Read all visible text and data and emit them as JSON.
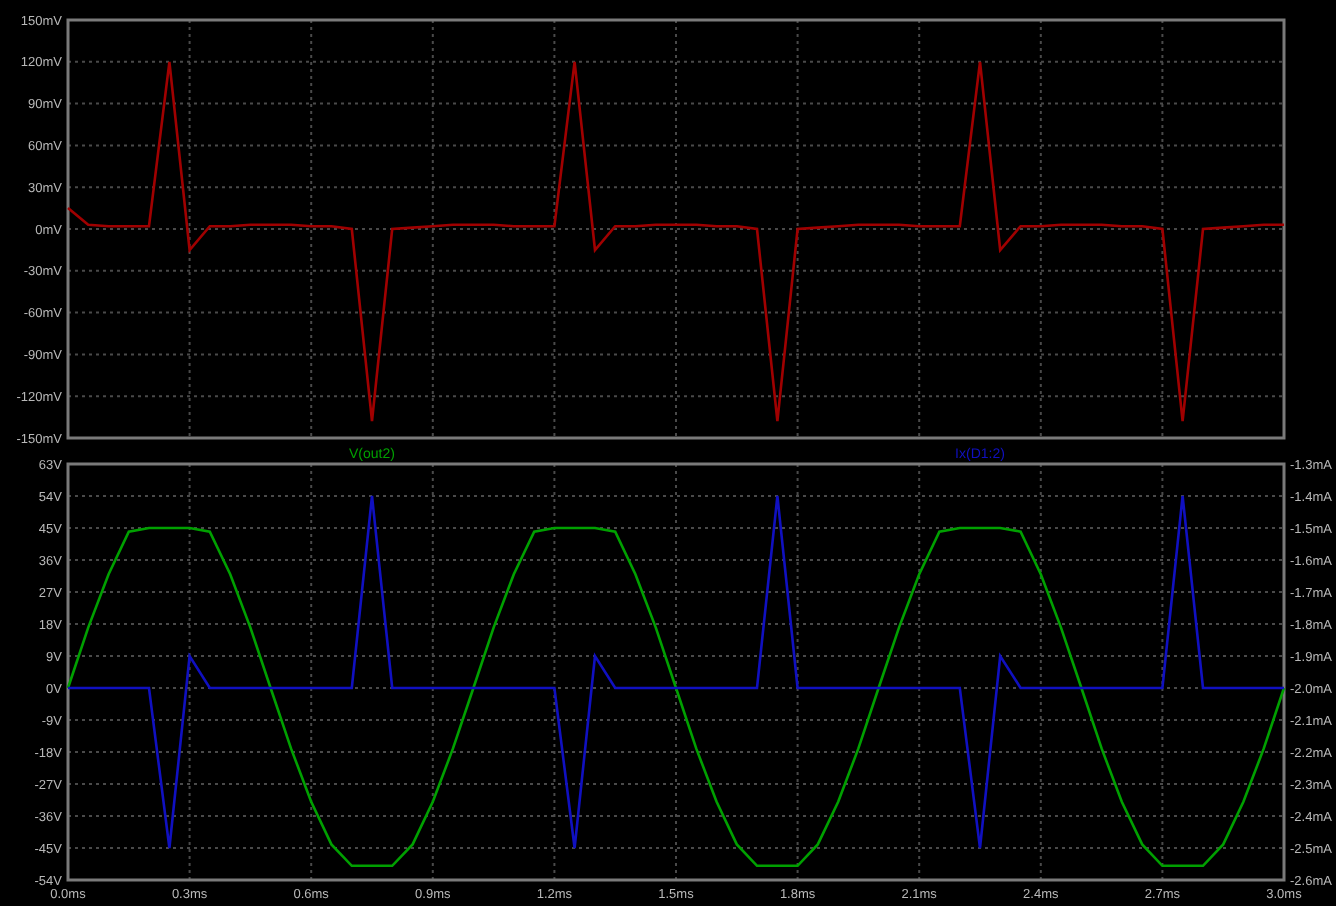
{
  "panes": [
    {
      "chart_data": {
        "type": "line",
        "x": [
          0,
          0.05,
          0.1,
          0.15,
          0.2,
          0.25,
          0.3,
          0.35,
          0.4,
          0.45,
          0.5,
          0.55,
          0.6,
          0.65,
          0.7,
          0.75,
          0.8,
          0.85,
          0.9,
          0.95,
          1,
          1.05,
          1.1,
          1.15,
          1.2,
          1.25,
          1.3,
          1.35,
          1.4,
          1.45,
          1.5,
          1.55,
          1.6,
          1.65,
          1.7,
          1.75,
          1.8,
          1.85,
          1.9,
          1.95,
          2,
          2.05,
          2.1,
          2.15,
          2.2,
          2.25,
          2.3,
          2.35,
          2.4,
          2.45,
          2.5,
          2.55,
          2.6,
          2.65,
          2.7,
          2.75,
          2.8,
          2.85,
          2.9,
          2.95,
          3
        ],
        "ylim": [
          -150,
          150
        ],
        "xlim": [
          0,
          3
        ],
        "grid": true,
        "yticks": [
          {
            "value": 150,
            "label": "150mV"
          },
          {
            "value": 120,
            "label": "120mV"
          },
          {
            "value": 90,
            "label": "90mV"
          },
          {
            "value": 60,
            "label": "60mV"
          },
          {
            "value": 30,
            "label": "30mV"
          },
          {
            "value": 0,
            "label": "0mV"
          },
          {
            "value": -30,
            "label": "-30mV"
          },
          {
            "value": -60,
            "label": "-60mV"
          },
          {
            "value": -90,
            "label": "-90mV"
          },
          {
            "value": -120,
            "label": "-120mV"
          },
          {
            "value": -150,
            "label": "-150mV"
          }
        ],
        "series": [
          {
            "color": "#a00000",
            "axis": "y",
            "values": [
              15,
              3,
              2,
              2,
              2,
              120,
              -15,
              2,
              2,
              3,
              3,
              3,
              2,
              2,
              0,
              -138,
              0,
              1,
              2,
              3,
              3,
              3,
              2,
              2,
              2,
              120,
              -15,
              2,
              2,
              3,
              3,
              3,
              2,
              2,
              0,
              -138,
              0,
              1,
              2,
              3,
              3,
              3,
              2,
              2,
              2,
              120,
              -15,
              2,
              2,
              3,
              3,
              3,
              2,
              2,
              0,
              -138,
              0,
              1,
              2,
              3,
              3
            ]
          }
        ]
      }
    },
    {
      "chart_data": {
        "type": "line",
        "x": [
          0,
          0.05,
          0.1,
          0.15,
          0.2,
          0.25,
          0.3,
          0.35,
          0.4,
          0.45,
          0.5,
          0.55,
          0.6,
          0.65,
          0.7,
          0.75,
          0.8,
          0.85,
          0.9,
          0.95,
          1,
          1.05,
          1.1,
          1.15,
          1.2,
          1.25,
          1.3,
          1.35,
          1.4,
          1.45,
          1.5,
          1.55,
          1.6,
          1.65,
          1.7,
          1.75,
          1.8,
          1.85,
          1.9,
          1.95,
          2,
          2.05,
          2.1,
          2.15,
          2.2,
          2.25,
          2.3,
          2.35,
          2.4,
          2.45,
          2.5,
          2.55,
          2.6,
          2.65,
          2.7,
          2.75,
          2.8,
          2.85,
          2.9,
          2.95,
          3
        ],
        "xlim": [
          0,
          3
        ],
        "ylim": [
          -54,
          63
        ],
        "y2lim": [
          -2.6,
          -1.3
        ],
        "grid": true,
        "xticks": [
          {
            "value": 0,
            "label": "0.0ms"
          },
          {
            "value": 0.3,
            "label": "0.3ms"
          },
          {
            "value": 0.6,
            "label": "0.6ms"
          },
          {
            "value": 0.9,
            "label": "0.9ms"
          },
          {
            "value": 1.2,
            "label": "1.2ms"
          },
          {
            "value": 1.5,
            "label": "1.5ms"
          },
          {
            "value": 1.8,
            "label": "1.8ms"
          },
          {
            "value": 2.1,
            "label": "2.1ms"
          },
          {
            "value": 2.4,
            "label": "2.4ms"
          },
          {
            "value": 2.7,
            "label": "2.7ms"
          },
          {
            "value": 3,
            "label": "3.0ms"
          }
        ],
        "yticks": [
          {
            "value": 63,
            "label": "63V"
          },
          {
            "value": 54,
            "label": "54V"
          },
          {
            "value": 45,
            "label": "45V"
          },
          {
            "value": 36,
            "label": "36V"
          },
          {
            "value": 27,
            "label": "27V"
          },
          {
            "value": 18,
            "label": "18V"
          },
          {
            "value": 9,
            "label": "9V"
          },
          {
            "value": 0,
            "label": "0V"
          },
          {
            "value": -9,
            "label": "-9V"
          },
          {
            "value": -18,
            "label": "-18V"
          },
          {
            "value": -27,
            "label": "-27V"
          },
          {
            "value": -36,
            "label": "-36V"
          },
          {
            "value": -45,
            "label": "-45V"
          },
          {
            "value": -54,
            "label": "-54V"
          }
        ],
        "y2ticks": [
          {
            "value": -1.3,
            "label": "-1.3mA"
          },
          {
            "value": -1.4,
            "label": "-1.4mA"
          },
          {
            "value": -1.5,
            "label": "-1.5mA"
          },
          {
            "value": -1.6,
            "label": "-1.6mA"
          },
          {
            "value": -1.7,
            "label": "-1.7mA"
          },
          {
            "value": -1.8,
            "label": "-1.8mA"
          },
          {
            "value": -1.9,
            "label": "-1.9mA"
          },
          {
            "value": -2.0,
            "label": "-2.0mA"
          },
          {
            "value": -2.1,
            "label": "-2.1mA"
          },
          {
            "value": -2.2,
            "label": "-2.2mA"
          },
          {
            "value": -2.3,
            "label": "-2.3mA"
          },
          {
            "value": -2.4,
            "label": "-2.4mA"
          },
          {
            "value": -2.5,
            "label": "-2.5mA"
          },
          {
            "value": -2.6,
            "label": "-2.6mA"
          }
        ],
        "series": [
          {
            "name": "V(out2)",
            "color": "#00a000",
            "axis": "y",
            "values": [
              0,
              17,
              32,
              44,
              45,
              45,
              45,
              44,
              32,
              17,
              0,
              -17,
              -32,
              -44,
              -50,
              -50,
              -50,
              -44,
              -32,
              -17,
              0,
              17,
              32,
              44,
              45,
              45,
              45,
              44,
              32,
              17,
              0,
              -17,
              -32,
              -44,
              -50,
              -50,
              -50,
              -44,
              -32,
              -17,
              0,
              17,
              32,
              44,
              45,
              45,
              45,
              44,
              32,
              17,
              0,
              -17,
              -32,
              -44,
              -50,
              -50,
              -50,
              -44,
              -32,
              -17,
              0
            ]
          },
          {
            "name": "Ix(D1:2)",
            "color": "#1010c0",
            "axis": "y2",
            "values": [
              -2.0,
              -2.0,
              -2.0,
              -2.0,
              -2.0,
              -2.5,
              -1.9,
              -2.0,
              -2.0,
              -2.0,
              -2.0,
              -2.0,
              -2.0,
              -2.0,
              -2.0,
              -1.4,
              -2.0,
              -2.0,
              -2.0,
              -2.0,
              -2.0,
              -2.0,
              -2.0,
              -2.0,
              -2.0,
              -2.5,
              -1.9,
              -2.0,
              -2.0,
              -2.0,
              -2.0,
              -2.0,
              -2.0,
              -2.0,
              -2.0,
              -1.4,
              -2.0,
              -2.0,
              -2.0,
              -2.0,
              -2.0,
              -2.0,
              -2.0,
              -2.0,
              -2.0,
              -2.5,
              -1.9,
              -2.0,
              -2.0,
              -2.0,
              -2.0,
              -2.0,
              -2.0,
              -2.0,
              -2.0,
              -1.4,
              -2.0,
              -2.0,
              -2.0,
              -2.0,
              -2.0
            ]
          }
        ]
      }
    }
  ]
}
